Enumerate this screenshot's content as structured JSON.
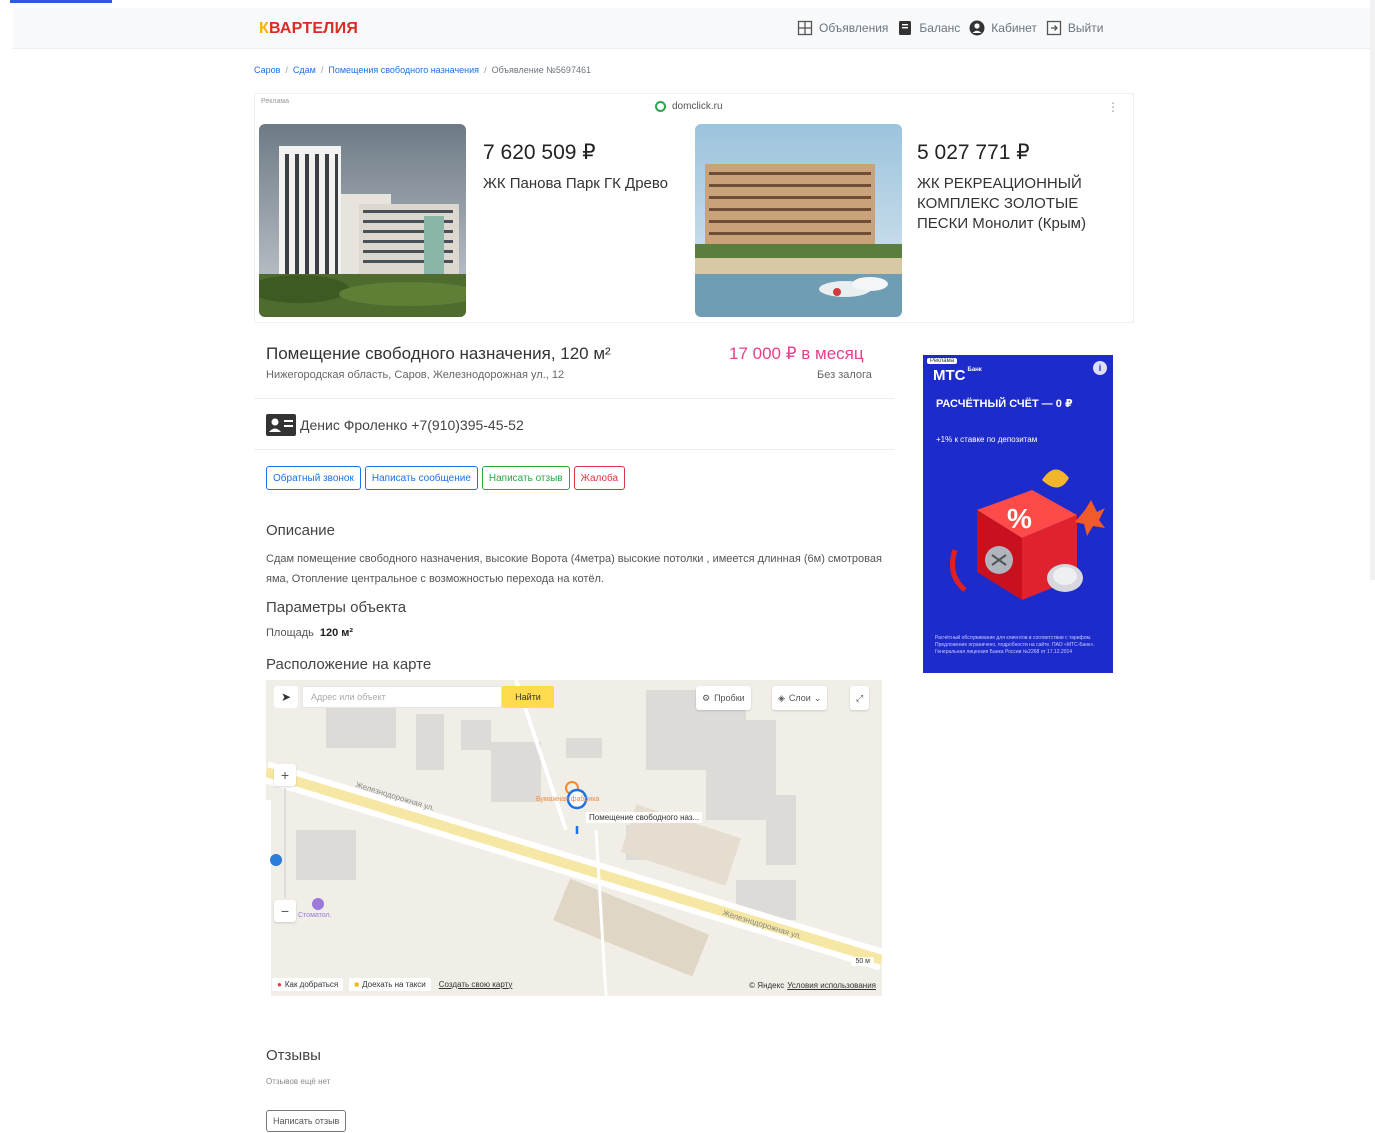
{
  "header": {
    "brand_first": "К",
    "brand_rest": "ВАРТЕЛИЯ",
    "nav": [
      {
        "label": "Объявления",
        "icon": "grid-icon"
      },
      {
        "label": "Баланс",
        "icon": "wallet-icon"
      },
      {
        "label": "Кабинет",
        "icon": "user-icon"
      },
      {
        "label": "Выйти",
        "icon": "logout-icon"
      }
    ]
  },
  "breadcrumb": [
    "Саров",
    "Сдам",
    "Помещения свободного назначения",
    "Объявление №5697461"
  ],
  "ad_block": {
    "label": "Реклама",
    "source": "domclick.ru",
    "cards": [
      {
        "price": "7 620 509 ₽",
        "name": "ЖК Панова Парк ГК Древо"
      },
      {
        "price": "5 027 771 ₽",
        "name": "ЖК РЕКРЕАЦИОННЫЙ КОМПЛЕКС ЗОЛОТЫЕ ПЕСКИ Монолит (Крым)"
      }
    ]
  },
  "listing": {
    "title": "Помещение свободного назначения, 120 м²",
    "address": "Нижегородская область, Саров, Железнодорожная ул., 12",
    "price": "17 000 ₽ в месяц",
    "deposit": "Без залога",
    "contact": "Денис Фроленко +7(910)395-45-52"
  },
  "actions": {
    "callback": "Обратный звонок",
    "message": "Написать сообщение",
    "review": "Написать отзыв",
    "complaint": "Жалоба"
  },
  "description": {
    "heading": "Описание",
    "text": "Сдам помещение свободного назначения, высокие Ворота (4метра) высокие потолки , имеется длинная (6м) смотровая яма, Отопление центральное с возможностью перехода на котёл."
  },
  "params": {
    "heading": "Параметры объекта",
    "area_label": "Площадь",
    "area_value": "120 м²"
  },
  "map": {
    "heading": "Расположение на карте",
    "search_placeholder": "Адрес или объект",
    "find_label": "Найти",
    "traffic_label": "Пробки",
    "layers_label": "Слои",
    "street_1": "Железнодорожная ул.",
    "street_2": "Железнодорожная ул.",
    "pin_label": "Помещение свободного наз...",
    "poi_1": "Бумажная фабрика",
    "poi_2": "Стоматол.",
    "route_label": "Как добраться",
    "taxi_label": "Доехать на такси",
    "create_map_label": "Создать свою карту",
    "copyright": "© Яндекс",
    "terms_label": "Условия использования",
    "scale_label": "50 м"
  },
  "reviews": {
    "heading": "Отзывы",
    "empty": "Отзывов ещё нет",
    "button": "Написать отзыв"
  },
  "side_ad": {
    "tag": "Реклама",
    "brand": "МТС",
    "brand_sub": "Банк",
    "headline": "РАСЧЁТНЫЙ СЧЁТ — 0 ₽",
    "subline": "+1% к ставке по депозитам",
    "fine_print": "Расчётный обслуживание для клиентов в соответствии с тарифом. Предложение ограничено, подробности на сайте. ПАО «МТС-Банк». Генеральная лицензия Банка России №2268 от 17.12.2014"
  },
  "colors": {
    "brand_red": "#dc2b24",
    "brand_yellow": "#f4b400",
    "price_pink": "#e83e8c",
    "link_blue": "#1a73e8",
    "mts_blue": "#1e2bcb"
  }
}
